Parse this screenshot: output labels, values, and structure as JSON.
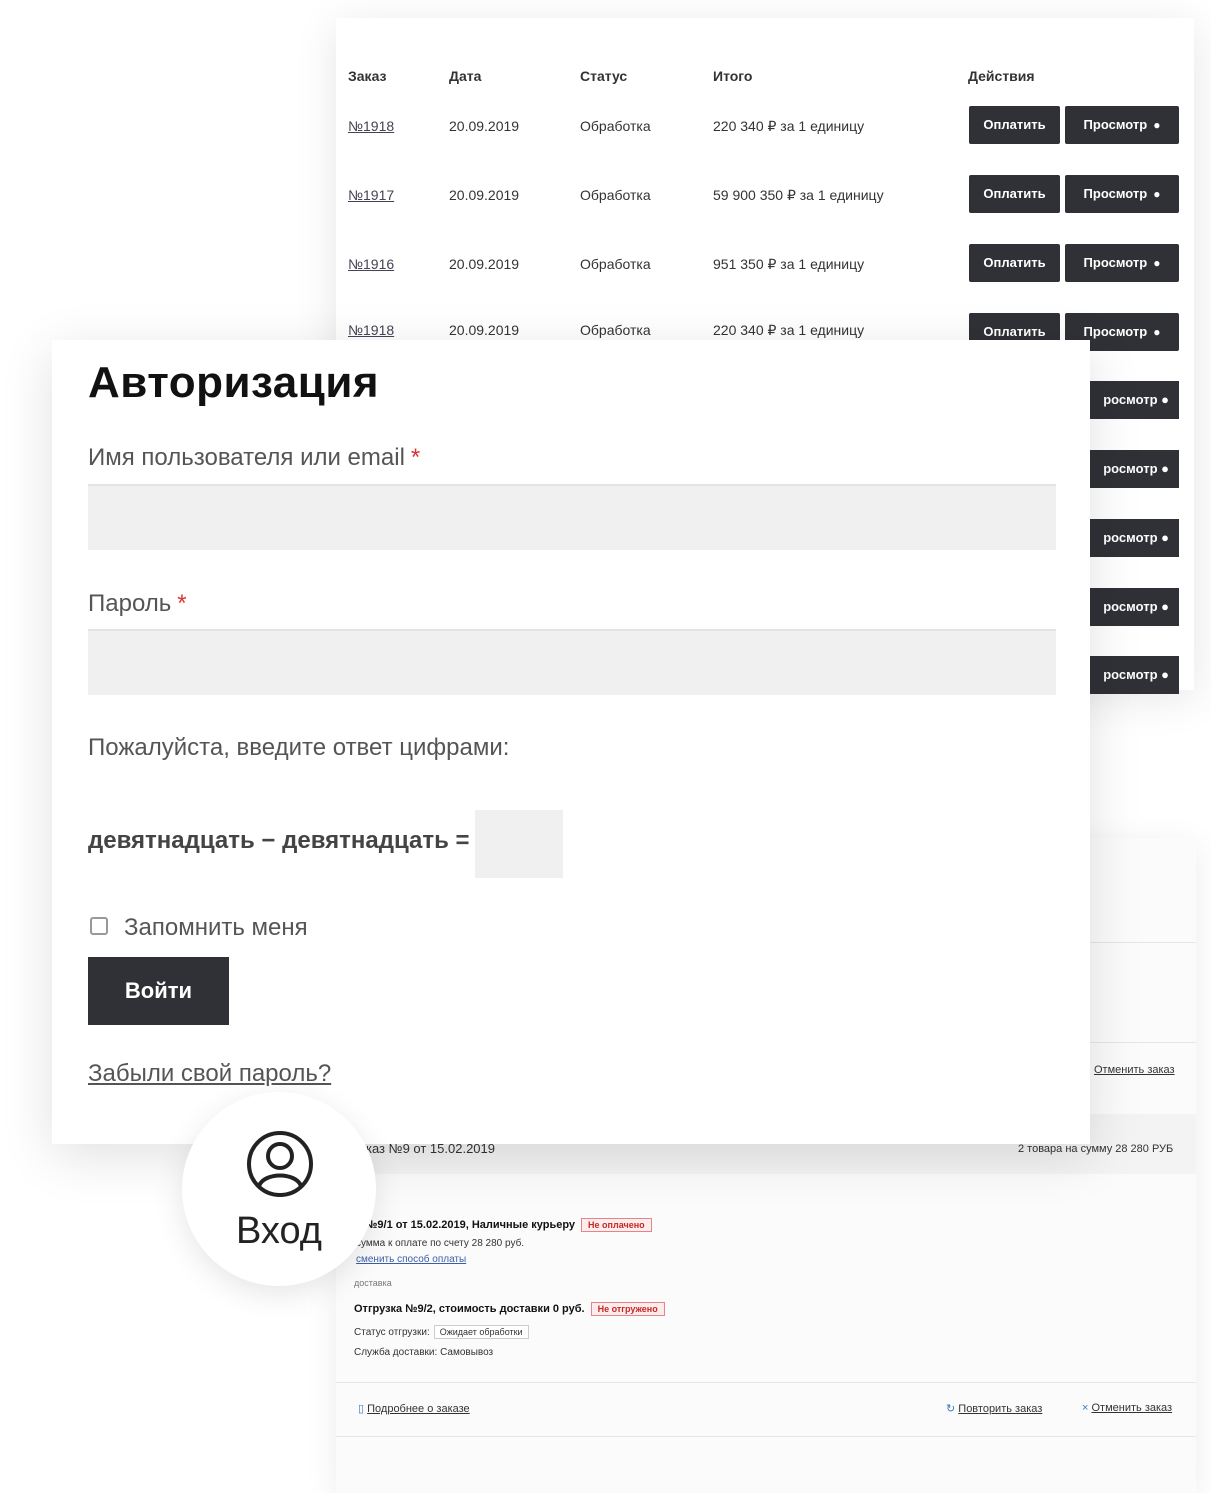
{
  "orders": {
    "headers": {
      "order": "Заказ",
      "date": "Дата",
      "status": "Статус",
      "total": "Итого",
      "actions": "Действия"
    },
    "rows": [
      {
        "number": "№1918",
        "date": "20.09.2019",
        "status": "Обработка",
        "total": "220 340 ₽ за 1 единицу"
      },
      {
        "number": "№1917",
        "date": "20.09.2019",
        "status": "Обработка",
        "total": "59 900 350 ₽ за 1 единицу"
      },
      {
        "number": "№1916",
        "date": "20.09.2019",
        "status": "Обработка",
        "total": "951 350 ₽ за 1 единицу"
      },
      {
        "number": "№1918",
        "date": "20.09.2019",
        "status": "Обработка",
        "total": "220 340 ₽ за 1 единицу"
      }
    ],
    "pay_label": "Оплатить",
    "view_label": "Просмотр",
    "view_label_partial": "росмотр",
    "eye_icon": "eye-icon"
  },
  "login": {
    "title": "Авторизация",
    "username_label": "Имя пользователя или email",
    "password_label": "Пароль",
    "required_mark": "*",
    "captcha_hint": "Пожалуйста, введите ответ цифрами:",
    "captcha_question": "девятнадцать − девятнадцать =",
    "remember_label": "Запомнить меня",
    "submit_label": "Войти",
    "forgot_label": "Забыли свой пароль?"
  },
  "entry": {
    "label": "Вход",
    "icon": "user-icon"
  },
  "order_details": {
    "cancel_top": "Отменить заказ",
    "header_left": "каз №9 от 15.02.2019",
    "header_right": "2 товара на сумму 28 280 РУБ",
    "payment_line": "а №9/1 от 15.02.2019, Наличные курьеру",
    "payment_badge": "Не оплачено",
    "payment_sum": "сумма к оплате по счету 28 280 руб.",
    "change_payment": "сменить способ оплаты",
    "delivery_label": "доставка",
    "shipment_line": "Отгрузка №9/2, стоимость доставки 0 руб.",
    "shipment_badge": "Не отгружено",
    "shipment_status_label": "Статус отгрузки:",
    "shipment_status_value": "Ожидает обработки",
    "delivery_service": "Служба доставки: Самовывоз",
    "details_link": "Подробнее о заказе",
    "repeat_link": "Повторить заказ",
    "cancel_bottom": "Отменить заказ"
  }
}
